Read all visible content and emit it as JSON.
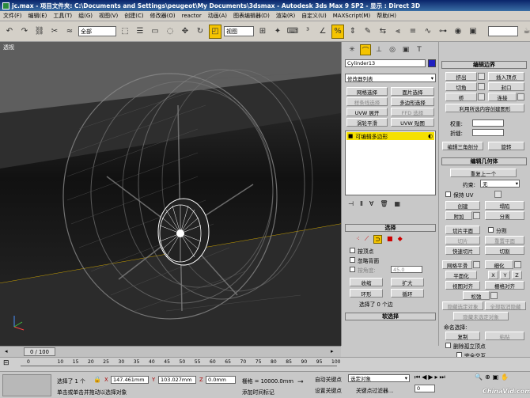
{
  "window": {
    "title": "jc.max - 项目文件夹: C:\\Documents and Settings\\peugeot\\My Documents\\3dsmax - Autodesk 3ds Max 9 SP2 - 显示 : Direct 3D"
  },
  "menu": [
    "文件(F)",
    "编辑(E)",
    "工具(T)",
    "组(G)",
    "视图(V)",
    "创建(C)",
    "修改器(O)",
    "reactor",
    "动画(A)",
    "图表编辑器(D)",
    "渲染(R)",
    "自定义(U)",
    "MAXScript(M)",
    "帮助(H)"
  ],
  "toolbar": {
    "selection_filter": "全部",
    "ref_coord": "视图"
  },
  "viewport": {
    "label": "透视"
  },
  "command_panel": {
    "object_name": "Cylinder13",
    "object_color": "#2020c0",
    "modifier_list_placeholder": "修改器列表",
    "mod_buttons": [
      "网格选择",
      "面片选择",
      "样条线选择",
      "多边形选择",
      "UVW 展开",
      "FFD 选择",
      "涡轮平滑",
      "UVW 贴图"
    ],
    "stack_item": "可编辑多边形",
    "stack_highlight": "#f5e000",
    "selection_rollout": {
      "title": "选择",
      "by_vertex": "按顶点",
      "ignore_backfacing": "忽略背面",
      "by_angle": "按角度:",
      "angle_value": "45.0",
      "shrink": "收缩",
      "grow": "扩大",
      "ring": "环形",
      "loop": "循环",
      "status": "选择了 0 个边"
    },
    "soft_selection": "软选择"
  },
  "right_panel": {
    "edit_edges": {
      "title": "编辑边界",
      "extrude": "挤出",
      "insert_vertex": "插入顶点",
      "chamfer": "切角",
      "cap": "封口",
      "bridge": "桥",
      "connect": "连接",
      "create_shape": "利用所选内容创建图形",
      "weight_label": "权重:",
      "crease_label": "折缝:",
      "edit_tri": "编辑三角剖分",
      "turn": "旋转"
    },
    "edit_geometry": {
      "title": "编辑几何体",
      "repeat_last": "重复上一个",
      "constraints_label": "约束:",
      "constraints_value": "无",
      "preserve_uv": "保持 UV",
      "create": "创建",
      "collapse": "塌陷",
      "attach": "附加",
      "detach": "分离",
      "slice_plane": "切片平面",
      "split": "分割",
      "slice": "切片",
      "reset_plane": "重置平面",
      "quickslice": "快速切片",
      "cut": "切割",
      "meshsmooth": "网格平滑",
      "tessellate": "细化",
      "make_planar": "平面化",
      "x": "X",
      "y": "Y",
      "z": "Z",
      "view_align": "视图对齐",
      "grid_align": "栅格对齐",
      "relax": "松弛",
      "hide_selected": "隐藏选定对象",
      "unhide_all": "全部取消隐藏",
      "hide_unselected": "隐藏未选定对象",
      "named_sel_label": "命名选择:",
      "copy": "复制",
      "paste": "粘贴",
      "delete_isolated": "删除孤立顶点",
      "full_interactivity": "完全交互"
    }
  },
  "timeline": {
    "frame_display": "0 / 100",
    "ticks": [
      "0",
      "10",
      "15",
      "20",
      "25",
      "30",
      "35",
      "40",
      "45",
      "50",
      "55",
      "60",
      "65",
      "70",
      "75",
      "80",
      "85",
      "90",
      "95",
      "100"
    ]
  },
  "status": {
    "selected": "选择了 1 个",
    "x_label": "X",
    "x_value": "147.461mm",
    "y_label": "Y",
    "y_value": "103.027mm",
    "z_label": "Z",
    "z_value": "0.0mm",
    "grid": "栅格 = 10000.0mm",
    "auto_key": "自动关键点",
    "key_filter_sel": "选定对象",
    "set_key": "设置关键点",
    "key_filters": "关键点过滤器...",
    "prompt": "单击或单击并拖动以选择对象",
    "add_time_tag": "添加时间标记",
    "frame_value": "0"
  },
  "watermark": "ChinaVid.com"
}
